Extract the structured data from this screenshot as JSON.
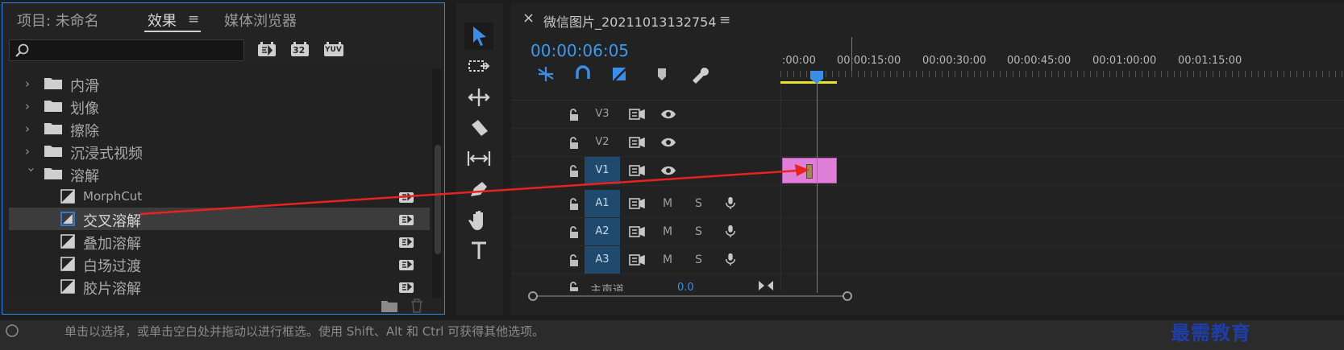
{
  "colors": {
    "accent": "#2d8ceb",
    "timecode": "#3b9af0",
    "clip": "#e07fd8",
    "arrow": "#e8231f",
    "work_area": "#e8e22c"
  },
  "effects_panel": {
    "tabs": [
      {
        "label": "项目: 未命名"
      },
      {
        "label": "效果"
      },
      {
        "label": "媒体浏览器"
      }
    ],
    "menu_glyph": "≡",
    "filter_buttons": [
      "accelerated-effects",
      "32-bit-color",
      "yuv-effects"
    ],
    "filter_labels": [
      "",
      "32",
      "YUV"
    ],
    "tree": [
      {
        "label": "内滑",
        "type": "folder",
        "expanded": false
      },
      {
        "label": "划像",
        "type": "folder",
        "expanded": false
      },
      {
        "label": "擦除",
        "type": "folder",
        "expanded": false
      },
      {
        "label": "沉浸式视频",
        "type": "folder",
        "expanded": false
      },
      {
        "label": "溶解",
        "type": "folder",
        "expanded": true
      },
      {
        "label": "MorphCut",
        "type": "transition"
      },
      {
        "label": "交叉溶解",
        "type": "transition",
        "selected": true
      },
      {
        "label": "叠加溶解",
        "type": "transition"
      },
      {
        "label": "白场过渡",
        "type": "transition"
      },
      {
        "label": "胶片溶解",
        "type": "transition"
      }
    ]
  },
  "timeline": {
    "close_glyph": "×",
    "sequence_name": "微信图片_20211013132754",
    "menu_glyph": "≡",
    "timecode": "00:00:06:05",
    "ruler": [
      ":00:00",
      "00:00:15:00",
      "00:00:30:00",
      "00:00:45:00",
      "00:01:00:00",
      "00:01:15:00"
    ],
    "video_tracks": [
      "V3",
      "V2",
      "V1"
    ],
    "audio_tracks": [
      "A1",
      "A2",
      "A3"
    ],
    "mute": "M",
    "solo": "S",
    "master_label": "主声道",
    "master_value": "0.0"
  },
  "status_bar": {
    "text": "单击以选择，或单击空白处并拖动以进行框选。使用 Shift、Alt 和 Ctrl 可获得其他选项。"
  },
  "watermark": "最需教育"
}
